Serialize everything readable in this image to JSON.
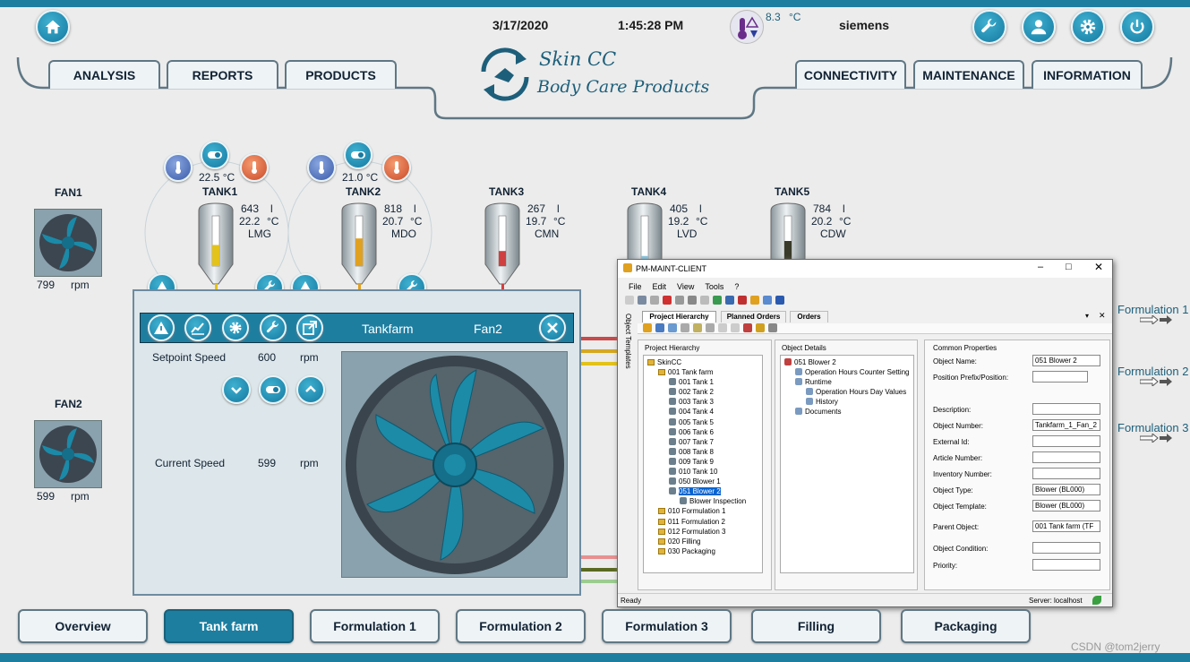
{
  "header": {
    "date": "3/17/2020",
    "time": "1:45:28 PM",
    "temp": "8.3",
    "temp_unit": "°C",
    "user": "siemens"
  },
  "top_tabs_left": [
    "ANALYSIS",
    "REPORTS",
    "PRODUCTS"
  ],
  "top_tabs_right": [
    "CONNECTIVITY",
    "MAINTENANCE",
    "INFORMATION"
  ],
  "logo": {
    "line1": "Skin CC",
    "line2": "Body Care Products"
  },
  "fans": [
    {
      "label": "FAN1",
      "value": "799",
      "unit": "rpm"
    },
    {
      "label": "FAN2",
      "value": "599",
      "unit": "rpm"
    }
  ],
  "controls": {
    "tank1_temp": "22.5 °C",
    "tank2_temp": "21.0 °C"
  },
  "tanks": [
    {
      "label": "TANK1",
      "level": "643",
      "level_unit": "l",
      "temp": "22.2",
      "temp_unit": "°C",
      "product": "LMG",
      "fill_color": "#e3c21a",
      "fill": 0.42
    },
    {
      "label": "TANK2",
      "level": "818",
      "level_unit": "l",
      "temp": "20.7",
      "temp_unit": "°C",
      "product": "MDO",
      "fill_color": "#e0a020",
      "fill": 0.55
    },
    {
      "label": "TANK3",
      "level": "267",
      "level_unit": "l",
      "temp": "19.7",
      "temp_unit": "°C",
      "product": "CMN",
      "fill_color": "#d04040",
      "fill": 0.3
    },
    {
      "label": "TANK4",
      "level": "405",
      "level_unit": "l",
      "temp": "19.2",
      "temp_unit": "°C",
      "product": "LVD",
      "fill_color": "#8cc8e0",
      "fill": 0.2
    },
    {
      "label": "TANK5",
      "level": "784",
      "level_unit": "l",
      "temp": "20.2",
      "temp_unit": "°C",
      "product": "CDW",
      "fill_color": "#3a3a2a",
      "fill": 0.5
    }
  ],
  "popup": {
    "title": "Tankfarm",
    "object": "Fan2",
    "setpoint_label": "Setpoint Speed",
    "setpoint_value": "600",
    "current_label": "Current Speed",
    "current_value": "599",
    "unit": "rpm"
  },
  "formulation_labels": [
    "Formulation 1",
    "Formulation 2",
    "Formulation 3"
  ],
  "bottom_tabs": [
    "Overview",
    "Tank farm",
    "Formulation 1",
    "Formulation 2",
    "Formulation 3",
    "Filling",
    "Packaging"
  ],
  "bottom_tab_active": "Tank farm",
  "app": {
    "title": "PM-MAINT-CLIENT",
    "menu": [
      "File",
      "Edit",
      "View",
      "Tools",
      "?"
    ],
    "tabs": [
      "Project Hierarchy",
      "Planned Orders",
      "Orders"
    ],
    "side_label": "Object Templates",
    "hierarchy_header": "Project Hierarchy",
    "details_header": "Object Details",
    "props_header": "Common Properties",
    "tree": [
      "SkinCC",
      "001 Tank farm",
      "001 Tank 1",
      "002 Tank 2",
      "003 Tank 3",
      "004 Tank 4",
      "005 Tank 5",
      "006 Tank 6",
      "007 Tank 7",
      "008 Tank 8",
      "009 Tank 9",
      "010 Tank 10",
      "050 Blower 1",
      "051 Blower 2",
      "Blower Inspection",
      "010 Formulation 1",
      "011 Formulation 2",
      "012 Formulation 3",
      "020 Filling",
      "030 Packaging"
    ],
    "details": [
      "051 Blower 2",
      "Operation Hours Counter Setting",
      "Runtime",
      "Operation Hours Day Values",
      "History",
      "Documents"
    ],
    "props": [
      {
        "label": "Object Name:",
        "value": "051 Blower 2"
      },
      {
        "label": "Position Prefix/Position:",
        "value": ""
      },
      {
        "label": "Description:",
        "value": ""
      },
      {
        "label": "Object Number:",
        "value": "Tankfarm_1_Fan_2"
      },
      {
        "label": "External Id:",
        "value": ""
      },
      {
        "label": "Article Number:",
        "value": ""
      },
      {
        "label": "Inventory Number:",
        "value": ""
      },
      {
        "label": "Object Type:",
        "value": "Blower (BL000)"
      },
      {
        "label": "Object Template:",
        "value": "Blower (BL000)"
      },
      {
        "label": "Parent Object:",
        "value": "001 Tank farm (TF"
      },
      {
        "label": "Object Condition:",
        "value": ""
      },
      {
        "label": "Priority:",
        "value": ""
      }
    ],
    "status_left": "Ready",
    "status_right": "Server:  localhost"
  },
  "watermark": "CSDN @tom2jerry"
}
